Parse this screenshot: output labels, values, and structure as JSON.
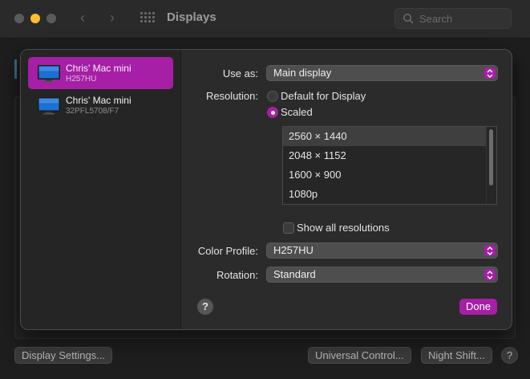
{
  "window": {
    "title": "Displays",
    "search_placeholder": "Search"
  },
  "background_buttons": {
    "display_settings": "Display Settings...",
    "universal_control": "Universal Control...",
    "night_shift": "Night Shift...",
    "help": "?"
  },
  "sidebar": {
    "items": [
      {
        "name": "Chris' Mac mini",
        "model": "H257HU",
        "selected": true
      },
      {
        "name": "Chris' Mac mini",
        "model": "32PFL5708/F7",
        "selected": false
      }
    ]
  },
  "form": {
    "use_as_label": "Use as:",
    "use_as_value": "Main display",
    "resolution_label": "Resolution:",
    "resolution_options": [
      "Default for Display",
      "Scaled"
    ],
    "resolution_selected": "Scaled",
    "resolutions": [
      "2560 × 1440",
      "2048 × 1152",
      "1600 × 900",
      "1080p"
    ],
    "selected_resolution": "2560 × 1440",
    "show_all_label": "Show all resolutions",
    "color_profile_label": "Color Profile:",
    "color_profile_value": "H257HU",
    "rotation_label": "Rotation:",
    "rotation_value": "Standard",
    "help": "?",
    "done": "Done"
  },
  "colors": {
    "accent": "#a61fa6",
    "minimize": "#febc2e"
  }
}
